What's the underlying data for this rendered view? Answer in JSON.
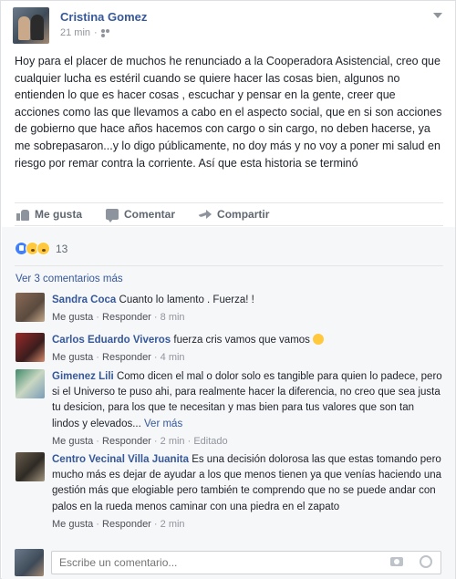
{
  "post": {
    "author": "Cristina Gomez",
    "time": "21 min",
    "text": "Hoy para el placer de muchos he renunciado a la Cooperadora Asistencial, creo que cualquier lucha es estéril cuando se quiere hacer las cosas bien, algunos no entienden lo que es hacer cosas , escuchar y pensar en la gente, creer que acciones como las que llevamos a cabo en el aspecto social, que en si son acciones de gobierno que hace años hacemos con cargo o sin cargo, no deben hacerse, ya me sobrepasaron...y lo digo públicamente, no doy más y no voy a poner mi salud en riesgo por remar contra la corriente. Así que esta historia se terminó"
  },
  "actions": {
    "like": "Me gusta",
    "comment": "Comentar",
    "share": "Compartir"
  },
  "reactions": {
    "count": "13",
    "types": [
      "like-icon",
      "sad-icon",
      "wow-icon"
    ]
  },
  "comments_section": {
    "view_more": "Ver 3 comentarios más",
    "like_label": "Me gusta",
    "reply_label": "Responder",
    "separator": " · ",
    "items": [
      {
        "name": "Sandra Coca",
        "text": "Cuanto lo lamento . Fuerza! !",
        "time": "8 min"
      },
      {
        "name": "Carlos Eduardo Viveros",
        "text": "fuerza cris vamos que vamos",
        "emoji": "smile-emoji-icon",
        "time": "4 min"
      },
      {
        "name": "Gimenez Lili",
        "text": "Como dicen el mal o dolor solo es tangible para quien lo padece, pero si el Universo te puso ahi, para realmente hacer la diferencia, no creo que sea justa tu desicion, para los que te necesitan y mas bien para tus valores que son tan lindos y elevados...",
        "more": "Ver más",
        "time": "2 min",
        "edited": "Editado"
      },
      {
        "name": "Centro Vecinal Villa Juanita",
        "text": "Es una decisión dolorosa las que estas tomando pero mucho más es dejar de ayudar a los que menos tienen ya que venías haciendo una gestión más que elogiable pero también te comprendo que no se puede andar con palos en la rueda menos caminar con una piedra en el zapato",
        "time": "2 min"
      }
    ]
  },
  "composer": {
    "placeholder": "Escribe un comentario..."
  },
  "colors": {
    "link": "#365899",
    "meta": "#90949c",
    "like_blue": "#4080ff",
    "reaction_yellow": "#ffc83d",
    "bg_grey": "#f6f7f9"
  }
}
